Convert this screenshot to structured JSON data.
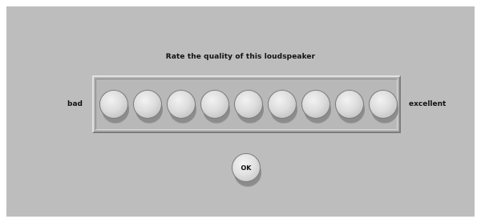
{
  "dialog": {
    "prompt": "Rate the quality of this loudspeaker",
    "scale_low_label": "bad",
    "scale_high_label": "excellent",
    "rating_options_count": 9,
    "ok_label": "OK"
  },
  "colors": {
    "background": "#bdbdbd",
    "button_face": "#dddddd",
    "text": "#111111"
  }
}
